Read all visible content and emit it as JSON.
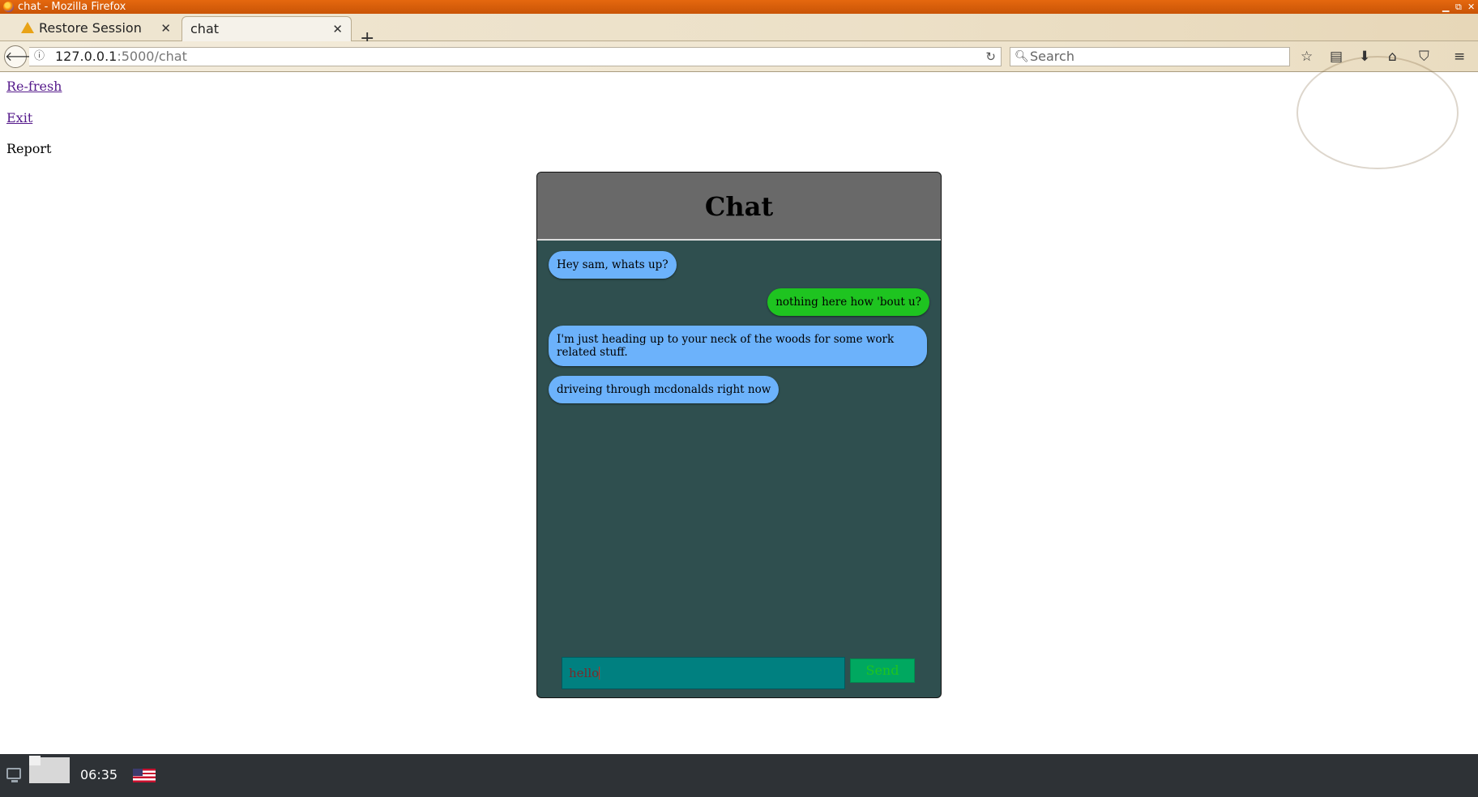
{
  "window": {
    "title": "chat - Mozilla Firefox"
  },
  "tabs": [
    {
      "label": "Restore Session",
      "active": false,
      "icon": "warning-icon"
    },
    {
      "label": "chat",
      "active": true
    }
  ],
  "navbar": {
    "url_host": "127.0.0.1",
    "url_path": ":5000/chat",
    "search_placeholder": "Search"
  },
  "page": {
    "links": {
      "refresh": "Re-fresh",
      "exit": "Exit"
    },
    "report_text": "Report"
  },
  "chat": {
    "title": "Chat",
    "messages": [
      {
        "from": "them",
        "text": "Hey sam, whats up?"
      },
      {
        "from": "me",
        "text": "nothing here how 'bout u?"
      },
      {
        "from": "them",
        "text": "I'm just heading up to your neck of the woods for some work related stuff."
      },
      {
        "from": "them",
        "text": "driveing through mcdonalds right now"
      }
    ],
    "input_value": "hello",
    "send_label": "Send",
    "colors": {
      "panel_bg": "#2f4f4f",
      "header_bg": "#696969",
      "incoming_bubble": "#6cb2fb",
      "outgoing_bubble": "#1ec420",
      "input_bg": "#008080",
      "send_bg": "#00a860"
    }
  },
  "taskbar": {
    "clock": "06:35"
  }
}
